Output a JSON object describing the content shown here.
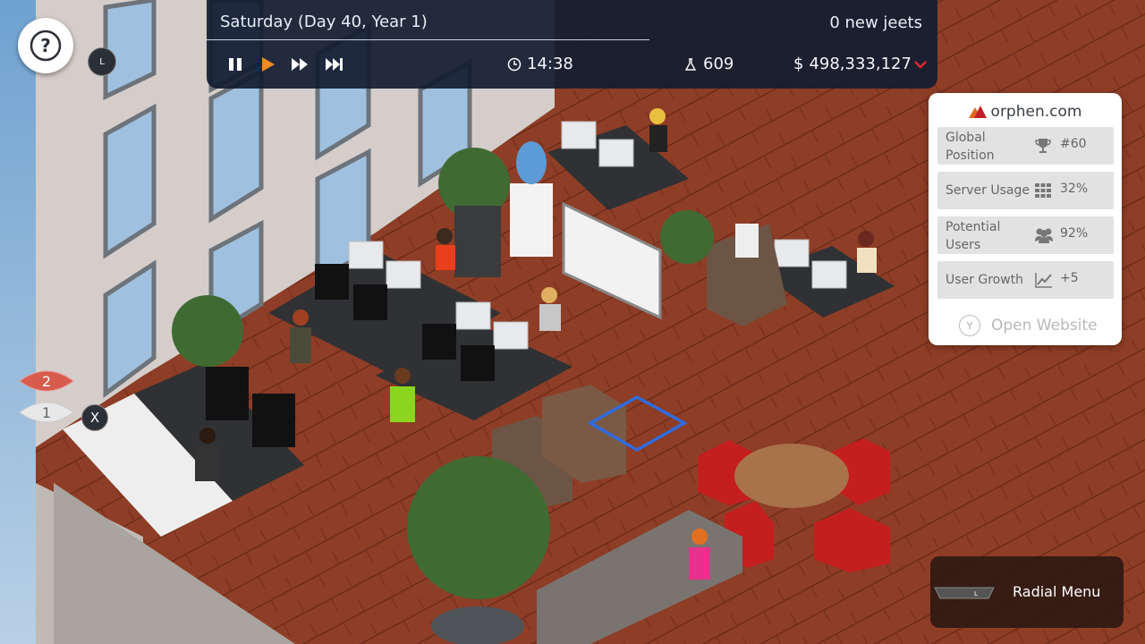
{
  "hud": {
    "date": "Saturday (Day 40, Year 1)",
    "jeets": "0 new jeets",
    "time": "14:38",
    "research": "609",
    "money_symbol": "$",
    "money": "498,333,127",
    "controls": [
      "pause-icon",
      "play-icon",
      "fast-forward-icon",
      "skip-to-end-icon"
    ],
    "accent_color": "#f08a24",
    "money_trend_color": "#e0262b"
  },
  "help": {
    "symbol": "?",
    "badge": "L"
  },
  "floors": {
    "upper": "2",
    "lower": "1",
    "close": "X",
    "upper_color": "#d75c4e"
  },
  "website": {
    "domain": "orphen.com",
    "rows": [
      {
        "label": "Global Position",
        "icon": "trophy-icon",
        "value": "#60"
      },
      {
        "label": "Server Usage",
        "icon": "grid-icon",
        "value": "32%"
      },
      {
        "label": "Potential Users",
        "icon": "users-icon",
        "value": "92%"
      },
      {
        "label": "User Growth",
        "icon": "trend-icon",
        "value": "+5"
      }
    ],
    "open_button": "Y",
    "open_label": "Open Website"
  },
  "radial": {
    "stick_label": "L",
    "label": "Radial Menu"
  }
}
